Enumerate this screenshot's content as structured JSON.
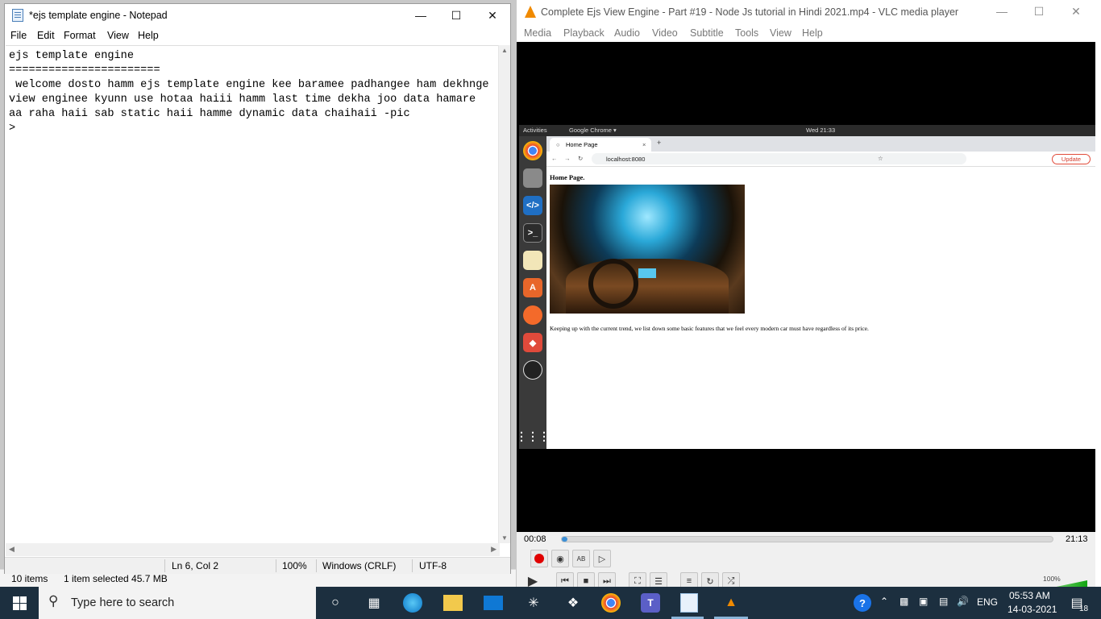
{
  "explorer": {
    "item_count": "10 items",
    "selection": "1 item selected  45.7 MB"
  },
  "notepad": {
    "title": "*ejs template engine - Notepad",
    "menu": [
      "File",
      "Edit",
      "Format",
      "View",
      "Help"
    ],
    "content": "ejs template engine\n=======================\n welcome dosto hamm ejs template engine kee baramee padhangee ham dekhnge\nview enginee kyunn use hotaa haiii hamm last time dekha joo data hamare\naa raha haii sab static haii hamme dynamic data chaihaii -pic\n>",
    "status": {
      "position": "Ln 6, Col 2",
      "zoom": "100%",
      "line_ending": "Windows (CRLF)",
      "encoding": "UTF-8"
    }
  },
  "vlc": {
    "title": "Complete Ejs View Engine - Part #19 - Node Js tutorial in Hindi 2021.mp4 - VLC media player",
    "menu": [
      "Media",
      "Playback",
      "Audio",
      "Video",
      "Subtitle",
      "Tools",
      "View",
      "Help"
    ],
    "elapsed": "00:08",
    "duration": "21:13",
    "progress": 0.006,
    "volume_label": "100%",
    "colors": {
      "progress": "#3b8fd6",
      "cone": "#f08a00"
    }
  },
  "video_content": {
    "ubuntu_topbar": {
      "activities": "Activities",
      "app": "Google Chrome ▾",
      "clock": "Wed 21:33"
    },
    "chrome": {
      "tab_title": "Home Page",
      "url": "localhost:8080",
      "update_label": "Update"
    },
    "page": {
      "heading": "Home Page.",
      "paragraph": "Keeping up with the current trend, we list down some basic features that we feel every modern car must have regardless of its price."
    }
  },
  "taskbar": {
    "search_placeholder": "Type here to search",
    "language": "ENG",
    "time": "05:53 AM",
    "date": "14-03-2021",
    "notification_count": "18"
  }
}
